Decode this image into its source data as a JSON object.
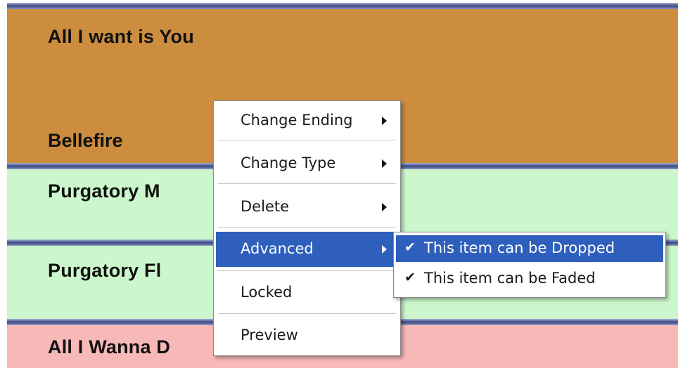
{
  "playlist": {
    "items": [
      {
        "title": "All I want is You",
        "subtitle": "Bellefire",
        "color": "#cc8d3f"
      },
      {
        "title": "Purgatory M",
        "color": "#ccf7cc"
      },
      {
        "title": "Purgatory Fl",
        "color": "#ccf7cc"
      },
      {
        "title": "All I Wanna D",
        "color": "#f7b8b8"
      }
    ]
  },
  "context_menu": {
    "items": [
      {
        "label": "Change Ending",
        "has_submenu": true
      },
      {
        "label": "Change Type",
        "has_submenu": true
      },
      {
        "label": "Delete",
        "has_submenu": true
      },
      {
        "label": "Advanced",
        "has_submenu": true,
        "highlighted": true
      },
      {
        "label": "Locked",
        "has_submenu": false
      },
      {
        "label": "Preview",
        "has_submenu": false
      }
    ],
    "advanced_submenu": [
      {
        "label": "This item can be Dropped",
        "checked": true,
        "highlighted": true,
        "check_icon": "✔"
      },
      {
        "label": "This item can be Faded",
        "checked": true,
        "check_icon": "✔"
      }
    ]
  },
  "colors": {
    "menu_highlight": "#2f5fbd",
    "separator_bar": "#4a5690"
  }
}
